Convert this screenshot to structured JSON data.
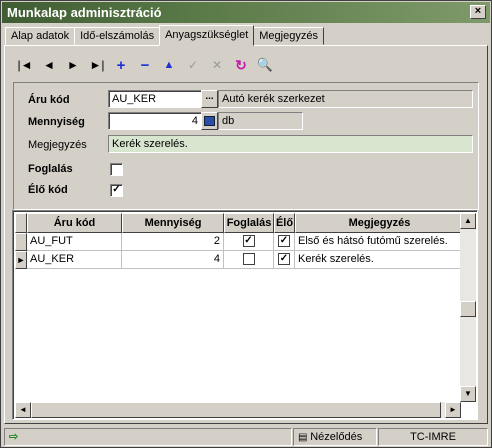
{
  "window": {
    "title": "Munkalap adminisztráció",
    "close_label": "×"
  },
  "tabs": [
    {
      "label": "Alap adatok"
    },
    {
      "label": "Idő-elszámolás"
    },
    {
      "label": "Anyagszükséglet"
    },
    {
      "label": "Megjegyzés"
    }
  ],
  "active_tab": "Anyagszükséglet",
  "toolbar": {
    "first": "first-record-icon",
    "prev": "prev-record-icon",
    "next": "next-record-icon",
    "last": "last-record-icon",
    "add": "add-icon",
    "delete": "delete-icon",
    "edit": "edit-icon",
    "post": "post-icon",
    "cancel": "cancel-icon",
    "refresh": "refresh-icon",
    "search": "search-icon",
    "glyphs": {
      "first": "|◄",
      "prev": "◄",
      "next": "►",
      "last": "►|",
      "add": "+",
      "delete": "−",
      "edit": "▲",
      "post": "✓",
      "cancel": "✕",
      "refresh": "↻",
      "search": "🔍"
    }
  },
  "form": {
    "aru_kod_label": "Áru kód",
    "aru_kod_value": "AU_KER",
    "lookup_button": "...",
    "aru_desc": "Autó kerék szerkezet",
    "mennyiseg_label": "Mennyiség",
    "mennyiseg_value": "4",
    "unit": "db",
    "megjegyzes_label": "Megjegyzés",
    "megjegyzes_value": "Kerék szerelés.",
    "foglalas_label": "Foglalás",
    "foglalas_checked": false,
    "elo_kod_label": "Élő kód",
    "elo_kod_checked": true
  },
  "grid": {
    "columns": [
      "Áru kód",
      "Mennyiség",
      "Foglalás",
      "Élő",
      "Megjegyzés"
    ],
    "rows": [
      {
        "aru_kod": "AU_FUT",
        "mennyiseg": "2",
        "foglalas": true,
        "elo": true,
        "megjegyzes": "Első és hátsó futómű szerelés.",
        "current": false
      },
      {
        "aru_kod": "AU_KER",
        "mennyiseg": "4",
        "foglalas": false,
        "elo": true,
        "megjegyzes": "Kerék szerelés.",
        "current": true
      }
    ],
    "row_indicator": "►",
    "check_glyph": "✓"
  },
  "status": {
    "mode": "Nézelődés",
    "user": "TC-IMRE"
  }
}
